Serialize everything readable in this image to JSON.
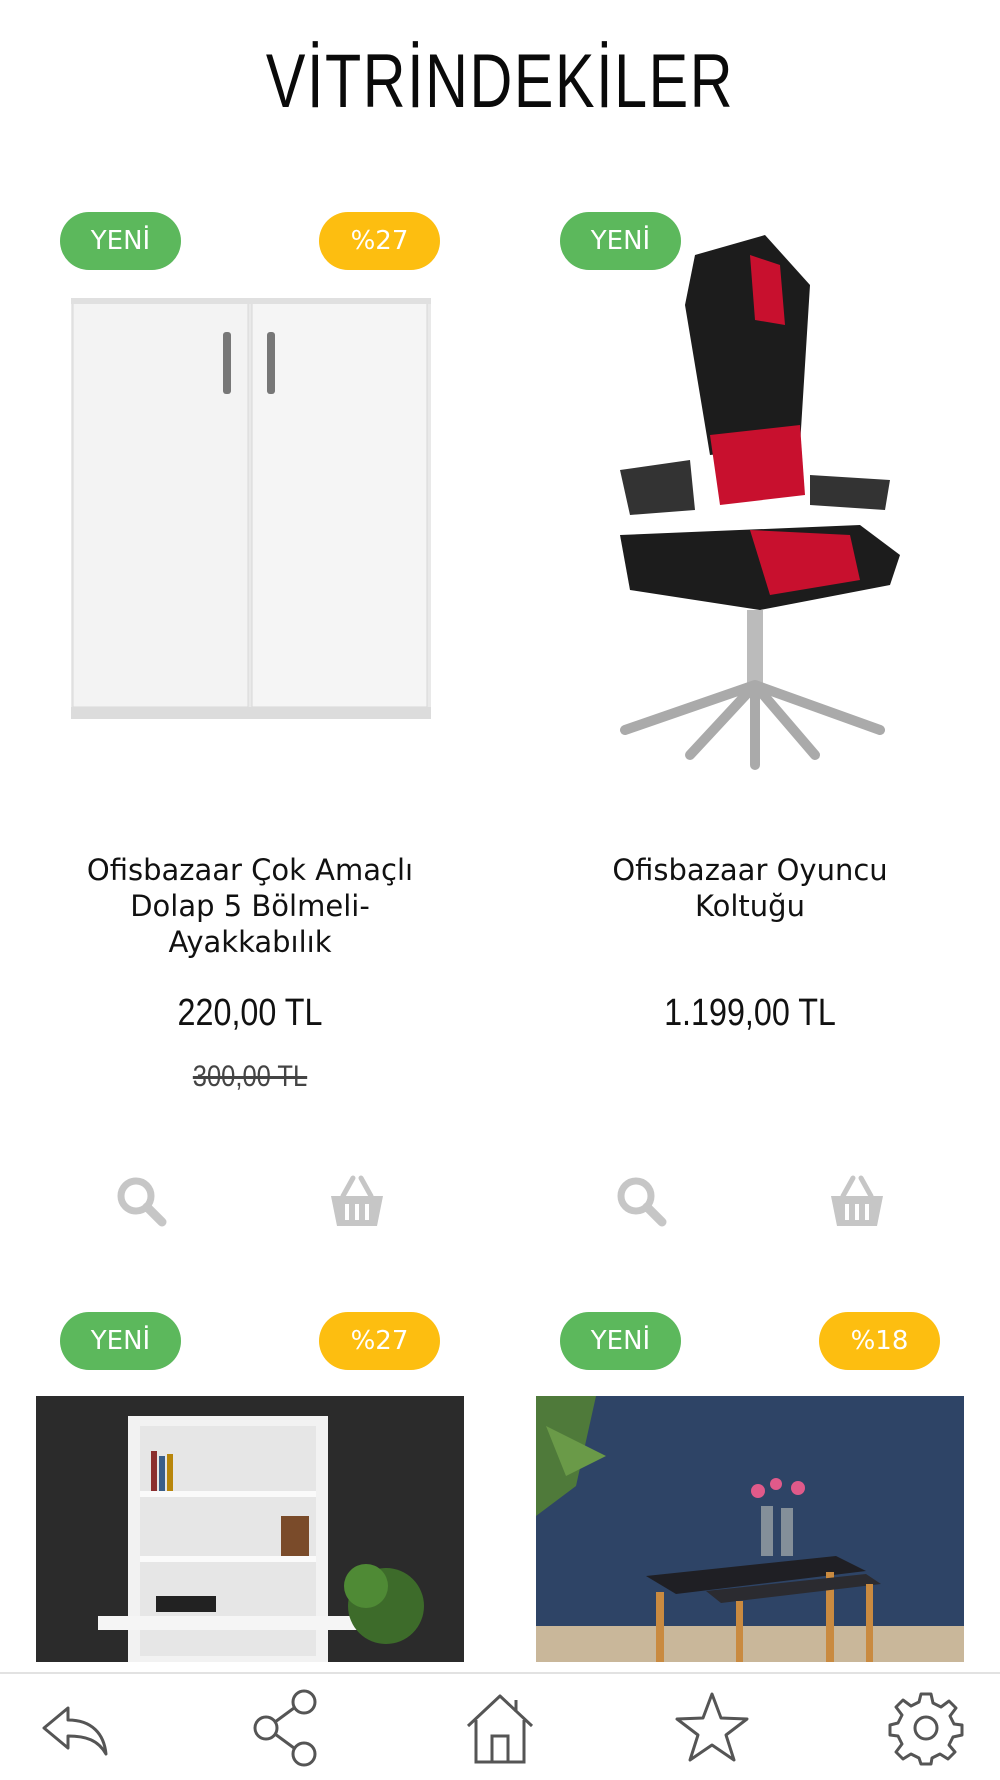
{
  "header": {
    "title": "VİTRİNDEKİLER"
  },
  "products": [
    {
      "name": "Ofisbazaar Çok Amaçlı Dolap 5 Bölmeli-Ayakkabılık",
      "price": "220,00 TL",
      "old_price": "300,00 TL",
      "badge_new": "YENİ",
      "badge_discount": "%27"
    },
    {
      "name": "Ofisbazaar Oyuncu Koltuğu",
      "price": "1.199,00 TL",
      "badge_new": "YENİ"
    },
    {
      "badge_new": "YENİ",
      "badge_discount": "%27"
    },
    {
      "badge_new": "YENİ",
      "badge_discount": "%18"
    }
  ],
  "icons": {
    "zoom": "search-icon",
    "cart": "basket-icon",
    "nav": [
      "back-icon",
      "share-icon",
      "home-icon",
      "star-icon",
      "gear-icon"
    ]
  },
  "colors": {
    "badge_new": "#5cb85c",
    "badge_discount": "#fdbe10",
    "action_icon": "#c6c6c6",
    "nav_icon": "#555555"
  }
}
